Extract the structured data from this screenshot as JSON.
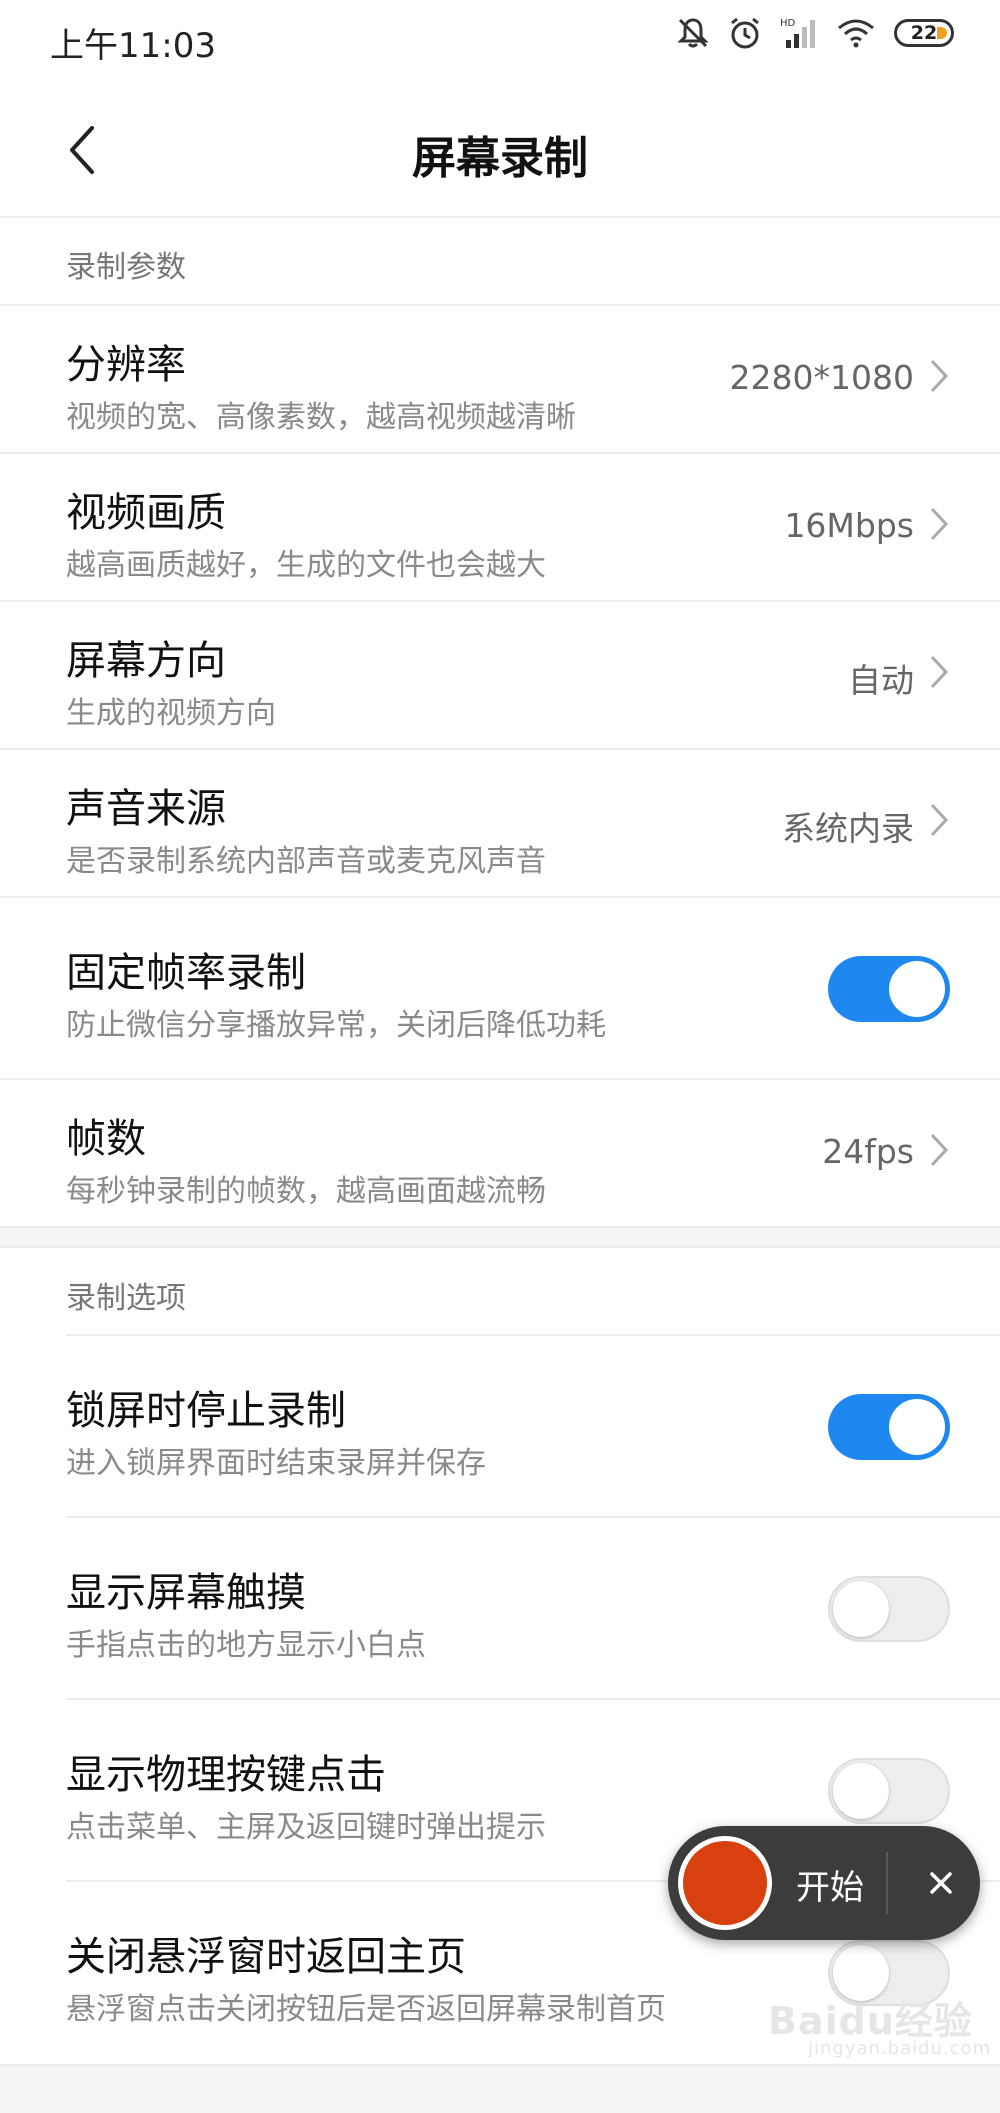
{
  "status_bar": {
    "time": "上午11:03",
    "battery": "22",
    "icons": [
      "mute-icon",
      "alarm-icon",
      "signal-icon",
      "wifi-icon",
      "battery-icon"
    ]
  },
  "header": {
    "title": "屏幕录制"
  },
  "section_params": {
    "title": "录制参数",
    "items": [
      {
        "label": "分辨率",
        "sub": "视频的宽、高像素数，越高视频越清晰",
        "value": "2280*1080"
      },
      {
        "label": "视频画质",
        "sub": "越高画质越好，生成的文件也会越大",
        "value": "16Mbps"
      },
      {
        "label": "屏幕方向",
        "sub": "生成的视频方向",
        "value": "自动"
      },
      {
        "label": "声音来源",
        "sub": "是否录制系统内部声音或麦克风声音",
        "value": "系统内录"
      },
      {
        "label": "固定帧率录制",
        "sub": "防止微信分享播放异常，关闭后降低功耗",
        "toggle": true
      },
      {
        "label": "帧数",
        "sub": "每秒钟录制的帧数，越高画面越流畅",
        "value": "24fps"
      }
    ]
  },
  "section_options": {
    "title": "录制选项",
    "items": [
      {
        "label": "锁屏时停止录制",
        "sub": "进入锁屏界面时结束录屏并保存",
        "toggle": true
      },
      {
        "label": "显示屏幕触摸",
        "sub": "手指点击的地方显示小白点",
        "toggle": false
      },
      {
        "label": "显示物理按键点击",
        "sub": "点击菜单、主屏及返回键时弹出提示",
        "toggle": false
      },
      {
        "label": "关闭悬浮窗时返回主页",
        "sub": "悬浮窗点击关闭按钮后是否返回屏幕录制首页",
        "toggle": false
      }
    ]
  },
  "floating_control": {
    "start_label": "开始"
  },
  "watermark": {
    "text": "Baidu经验",
    "sub": "jingyan.baidu.com"
  },
  "colors": {
    "toggle_on": "#1e88f0",
    "record": "#d9400f"
  }
}
